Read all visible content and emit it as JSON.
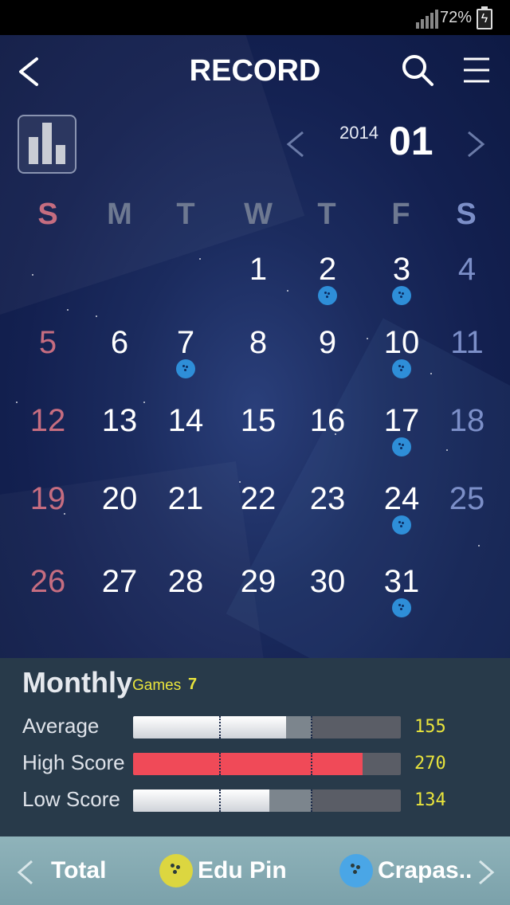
{
  "status_bar": {
    "battery_percent": "72%",
    "charging": true
  },
  "header": {
    "title": "RECORD",
    "icons": [
      "back-icon",
      "search-icon",
      "menu-icon",
      "bar-chart-icon"
    ]
  },
  "month_nav": {
    "year": "2014",
    "month": "01"
  },
  "weekdays": [
    "S",
    "M",
    "T",
    "W",
    "T",
    "F",
    "S"
  ],
  "colors": {
    "sunday": "#c66d80",
    "saturday": "#7c8fc8",
    "weekday_header": "#6e7991",
    "game_ball": "#2e8ed8",
    "score_value": "#e9e43c"
  },
  "calendar": {
    "days": [
      "1",
      "2",
      "3",
      "4",
      "5",
      "6",
      "7",
      "8",
      "9",
      "10",
      "11",
      "12",
      "13",
      "14",
      "15",
      "16",
      "17",
      "18",
      "19",
      "20",
      "21",
      "22",
      "23",
      "24",
      "25",
      "26",
      "27",
      "28",
      "29",
      "30",
      "31"
    ],
    "days_with_games": [
      "2",
      "3",
      "7",
      "10",
      "17",
      "24",
      "31"
    ]
  },
  "monthly": {
    "title": "Monthly",
    "games_label": "Games",
    "games_value": "7",
    "stats": [
      {
        "label": "Average",
        "value": "155"
      },
      {
        "label": "High Score",
        "value": "270"
      },
      {
        "label": "Low Score",
        "value": "134"
      }
    ]
  },
  "tabs": [
    {
      "label": "Total"
    },
    {
      "label": "Edu Pin",
      "ball_color": "#dcd640"
    },
    {
      "label": "Crapas..",
      "ball_color": "#4aa6e6"
    }
  ]
}
